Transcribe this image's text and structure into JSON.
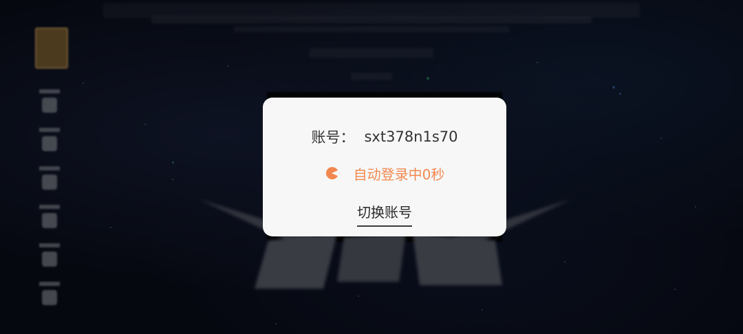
{
  "dialog": {
    "account_label": "账号：",
    "account_value": "sxt378n1s70",
    "status_text": "自动登录中0秒",
    "switch_account_label": "切换账号"
  },
  "colors": {
    "accent": "#f2884f",
    "dialog_bg": "#f7f7f7",
    "text": "#333333"
  },
  "icons": {
    "loading": "loading-spinner-icon"
  }
}
